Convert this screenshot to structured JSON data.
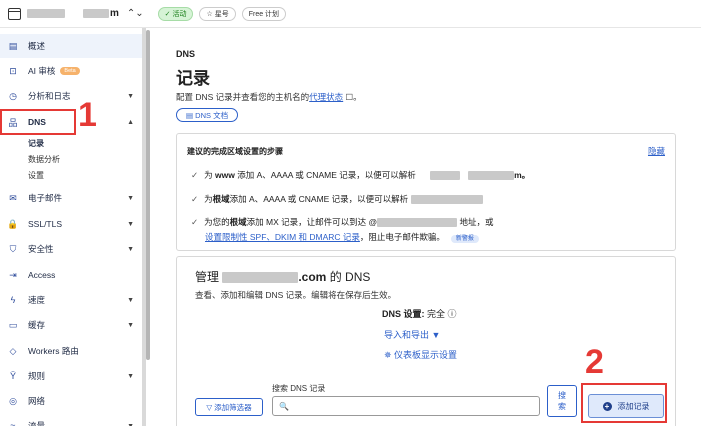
{
  "topbar": {
    "account_suffix": "m",
    "chevron": "⌃⌄",
    "status_badge": "✓ 活动",
    "star_badge": "☆ 星号",
    "plan_badge": "Free 计划"
  },
  "sidebar": {
    "items": [
      {
        "icon": "document-icon",
        "glyph": "▤",
        "label": "概述"
      },
      {
        "icon": "ai-audit-icon",
        "glyph": "⊡",
        "label": "AI 审核",
        "badge": "Beta"
      },
      {
        "icon": "analytics-icon",
        "glyph": "◷",
        "label": "分析和日志"
      },
      {
        "icon": "dns-network-icon",
        "glyph": "品",
        "label": "DNS"
      },
      {
        "icon": "email-icon",
        "glyph": "✉",
        "label": "电子邮件"
      },
      {
        "icon": "lock-icon",
        "glyph": "🔒",
        "label": "SSL/TLS"
      },
      {
        "icon": "shield-icon",
        "glyph": "⛉",
        "label": "安全性"
      },
      {
        "icon": "access-icon",
        "glyph": "⇥",
        "label": "Access"
      },
      {
        "icon": "speed-icon",
        "glyph": "ϟ",
        "label": "速度"
      },
      {
        "icon": "cache-icon",
        "glyph": "▭",
        "label": "缓存"
      },
      {
        "icon": "workers-icon",
        "glyph": "◇",
        "label": "Workers 路由"
      },
      {
        "icon": "rules-icon",
        "glyph": "Ÿ",
        "label": "规则"
      },
      {
        "icon": "network-icon",
        "glyph": "◎",
        "label": "网络"
      },
      {
        "icon": "traffic-icon",
        "glyph": "≈",
        "label": "流量"
      }
    ],
    "dns_subitems": [
      "记录",
      "数据分析",
      "设置"
    ]
  },
  "annotations": {
    "num1": "1",
    "num2": "2"
  },
  "main": {
    "breadcrumb": "DNS",
    "title": "记录",
    "desc_prefix": "配置 DNS 记录并查看您的主机名的",
    "desc_link": "代理状态",
    "desc_suffix": " ☐。",
    "doc_button": "▤ DNS 文档",
    "steps": {
      "title": "建议的完成区域设置的步骤",
      "hide_link": "隐藏",
      "step1_a": "为 ",
      "step1_b": "www",
      "step1_c": " 添加 A、AAAA 或 CNAME 记录，以便可以解析 ",
      "step1_d": "m。",
      "step2_a": "为",
      "step2_b": "根域",
      "step2_c": "添加 A、AAAA 或 CNAME 记录，以便可以解析 ",
      "step3_a": "为您的",
      "step3_b": "根域",
      "step3_c": "添加 MX 记录，让邮件可以到达 @",
      "step3_d": " 地址，或",
      "step3_link": "设置限制性 SPF、DKIM 和 DMARC 记录",
      "step3_e": "，阻止电子邮件欺骗。",
      "new_badge": "新警报"
    },
    "dns": {
      "title_prefix": "管理 ",
      "title_domain": ".com",
      "title_suffix": " 的 DNS",
      "desc": "查看、添加和编辑 DNS 记录。编辑将在保存后生效。",
      "setting_label": "DNS 设置:",
      "setting_value": " 完全 ⓘ",
      "import_export": "导入和导出 ▼",
      "dashboard_settings": "✵ 仪表板显示设置",
      "search_label": "搜索 DNS 记录",
      "filter_button": "▽ 添加筛选器",
      "search_icon": "🔍",
      "search_button": "搜\n索",
      "add_record_button": "添加记录"
    }
  }
}
